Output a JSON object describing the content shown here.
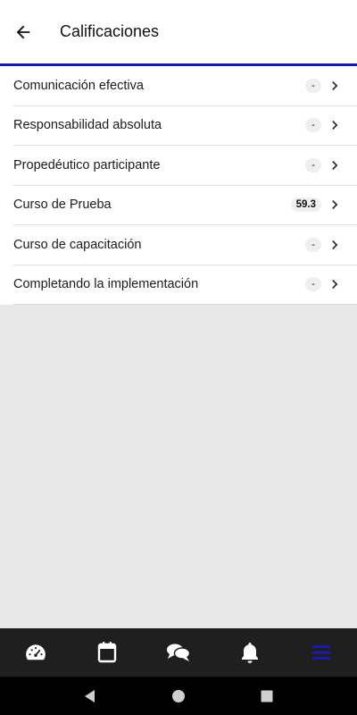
{
  "header": {
    "title": "Calificaciones",
    "back_icon": "arrow-left-icon"
  },
  "courses": [
    {
      "name": "Comunicación efectiva",
      "grade": "-"
    },
    {
      "name": "Responsabilidad absoluta",
      "grade": "-"
    },
    {
      "name": "Propedéutico participante",
      "grade": "-"
    },
    {
      "name": "Curso de Prueba",
      "grade": "59.3"
    },
    {
      "name": "Curso de capacitación",
      "grade": "-"
    },
    {
      "name": "Completando la implementación",
      "grade": "-"
    }
  ],
  "bottom_nav": {
    "items": [
      "dashboard-gauge-icon",
      "calendar-icon",
      "chat-icon",
      "bell-icon",
      "menu-icon"
    ],
    "active": "menu-icon",
    "active_color": "#1a1aa6"
  },
  "system_nav": {
    "items": [
      "back-triangle-icon",
      "home-circle-icon",
      "recents-square-icon"
    ]
  },
  "colors": {
    "accent": "#1a1aa6",
    "nav_background": "#1f1f1f",
    "page_background": "#e8e8e8"
  }
}
